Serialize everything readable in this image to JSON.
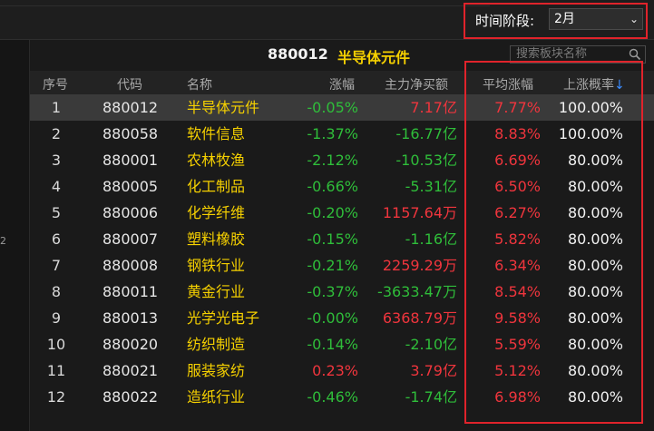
{
  "toolbar": {
    "period_label": "时间阶段:",
    "period_value": "2月"
  },
  "left_panel": {
    "mark": "2"
  },
  "panel": {
    "code": "880012",
    "name": "半导体元件",
    "search_placeholder": "搜索板块名称"
  },
  "columns": {
    "idx": "序号",
    "code": "代码",
    "name": "名称",
    "change": "涨幅",
    "net_flow": "主力净买额",
    "avg_change": "平均涨幅",
    "up_prob": "上涨概率",
    "sort_indicator": "↓"
  },
  "colors": {
    "positive": "#f0353d",
    "negative": "#2fbd3a",
    "name_yellow": "#f5d000",
    "highlight_border": "#e0232b"
  },
  "rows": [
    {
      "idx": "1",
      "code": "880012",
      "name": "半导体元件",
      "change": "-0.05%",
      "change_dir": "down",
      "flow": "7.17亿",
      "flow_dir": "up",
      "avg": "7.77%",
      "prob": "100.00%"
    },
    {
      "idx": "2",
      "code": "880058",
      "name": "软件信息",
      "change": "-1.37%",
      "change_dir": "down",
      "flow": "-16.77亿",
      "flow_dir": "down",
      "avg": "8.83%",
      "prob": "100.00%"
    },
    {
      "idx": "3",
      "code": "880001",
      "name": "农林牧渔",
      "change": "-2.12%",
      "change_dir": "down",
      "flow": "-10.53亿",
      "flow_dir": "down",
      "avg": "6.69%",
      "prob": "80.00%"
    },
    {
      "idx": "4",
      "code": "880005",
      "name": "化工制品",
      "change": "-0.66%",
      "change_dir": "down",
      "flow": "-5.31亿",
      "flow_dir": "down",
      "avg": "6.50%",
      "prob": "80.00%"
    },
    {
      "idx": "5",
      "code": "880006",
      "name": "化学纤维",
      "change": "-0.20%",
      "change_dir": "down",
      "flow": "1157.64万",
      "flow_dir": "up",
      "avg": "6.27%",
      "prob": "80.00%"
    },
    {
      "idx": "6",
      "code": "880007",
      "name": "塑料橡胶",
      "change": "-0.15%",
      "change_dir": "down",
      "flow": "-1.16亿",
      "flow_dir": "down",
      "avg": "5.82%",
      "prob": "80.00%"
    },
    {
      "idx": "7",
      "code": "880008",
      "name": "钢铁行业",
      "change": "-0.21%",
      "change_dir": "down",
      "flow": "2259.29万",
      "flow_dir": "up",
      "avg": "6.34%",
      "prob": "80.00%"
    },
    {
      "idx": "8",
      "code": "880011",
      "name": "黄金行业",
      "change": "-0.37%",
      "change_dir": "down",
      "flow": "-3633.47万",
      "flow_dir": "down",
      "avg": "8.54%",
      "prob": "80.00%"
    },
    {
      "idx": "9",
      "code": "880013",
      "name": "光学光电子",
      "change": "-0.00%",
      "change_dir": "down",
      "flow": "6368.79万",
      "flow_dir": "up",
      "avg": "9.58%",
      "prob": "80.00%"
    },
    {
      "idx": "10",
      "code": "880020",
      "name": "纺织制造",
      "change": "-0.14%",
      "change_dir": "down",
      "flow": "-2.10亿",
      "flow_dir": "down",
      "avg": "5.59%",
      "prob": "80.00%"
    },
    {
      "idx": "11",
      "code": "880021",
      "name": "服装家纺",
      "change": "0.23%",
      "change_dir": "up",
      "flow": "3.79亿",
      "flow_dir": "up",
      "avg": "5.12%",
      "prob": "80.00%"
    },
    {
      "idx": "12",
      "code": "880022",
      "name": "造纸行业",
      "change": "-0.46%",
      "change_dir": "down",
      "flow": "-1.74亿",
      "flow_dir": "down",
      "avg": "6.98%",
      "prob": "80.00%"
    }
  ],
  "selected_row": 0
}
